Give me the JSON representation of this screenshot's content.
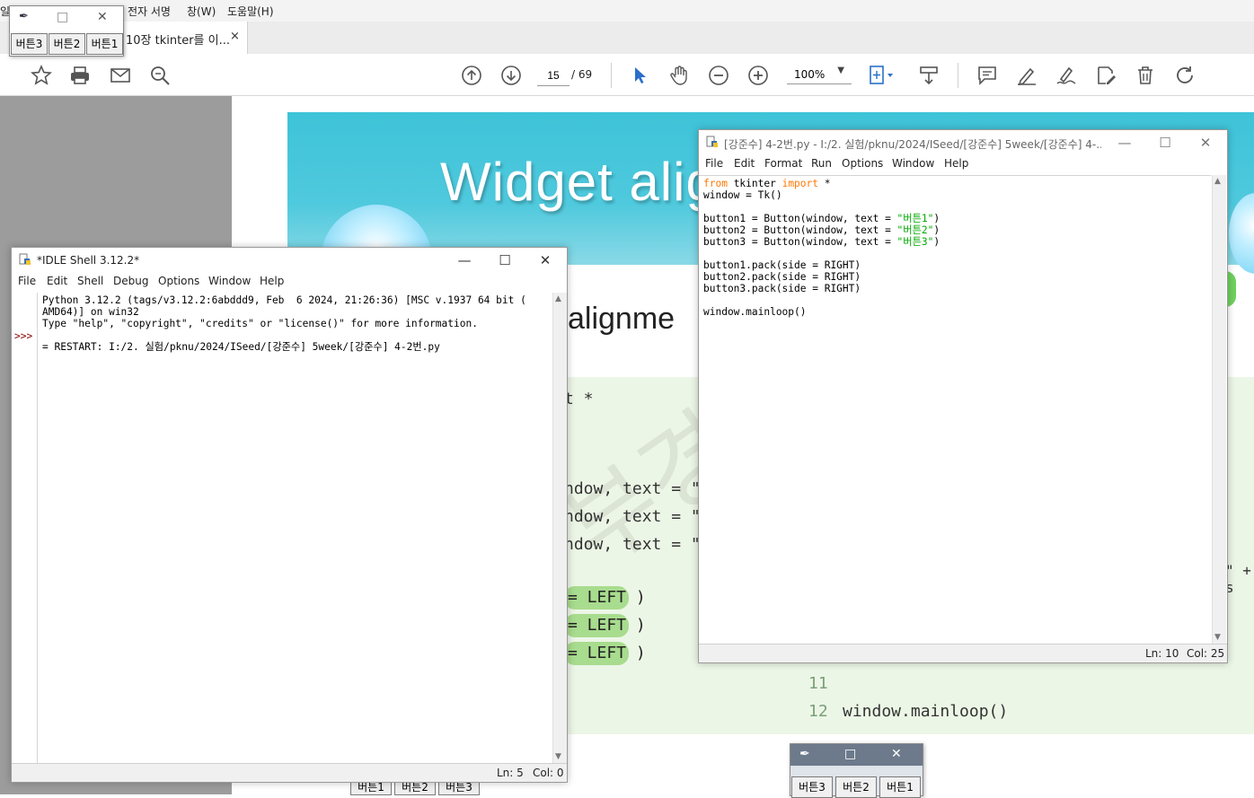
{
  "pdf_reader": {
    "menu": [
      "일",
      "전자 서명",
      "창(W)",
      "도움말(H)"
    ],
    "tab_title": "10장 tkinter를 이...",
    "tab_close": "×",
    "page_current": "15",
    "page_total": "/ 69",
    "zoom": "100%"
  },
  "slide": {
    "title": "Widget alig",
    "subtitle": "alignme",
    "code_fragments": [
      "t *",
      "ndow, text = \"버",
      "ndow, text = \"버",
      "ndow, text = \"버"
    ],
    "left_labels": [
      "= LEFT )",
      "= LEFT )",
      "= LEFT )"
    ],
    "line_11": "11",
    "line_12": "12",
    "line_12_code": "window.mainloop()",
    "watermark": "부경대 P",
    "right_edge_text": "\" + s"
  },
  "tk_window_top": {
    "buttons": [
      "버튼3",
      "버튼2",
      "버튼1"
    ],
    "maximize": "□",
    "close": "✕"
  },
  "tk_window_bottom": {
    "buttons": [
      "버튼3",
      "버튼2",
      "버튼1"
    ],
    "maximize": "□",
    "close": "✕"
  },
  "bottom_pack_buttons": [
    "버튼1",
    "버튼2",
    "버튼3"
  ],
  "idle_shell": {
    "title": "*IDLE Shell 3.12.2*",
    "menu": [
      "File",
      "Edit",
      "Shell",
      "Debug",
      "Options",
      "Window",
      "Help"
    ],
    "prompt": ">>>",
    "lines": [
      "Python 3.12.2 (tags/v3.12.2:6abddd9, Feb  6 2024, 21:26:36) [MSC v.1937 64 bit (",
      "AMD64)] on win32",
      "Type \"help\", \"copyright\", \"credits\" or \"license()\" for more information.",
      "",
      "= RESTART: I:/2. 실험/pknu/2024/ISeed/[강준수] 5week/[강준수] 4-2번.py"
    ],
    "status_ln": "Ln: 5",
    "status_col": "Col: 0"
  },
  "idle_editor": {
    "title": "[강준수] 4-2번.py - I:/2. 실험/pknu/2024/ISeed/[강준수] 5week/[강준수] 4-...",
    "menu": [
      "File",
      "Edit",
      "Format",
      "Run",
      "Options",
      "Window",
      "Help"
    ],
    "code": {
      "l1_kw1": "from",
      "l1_mid": " tkinter ",
      "l1_kw2": "import",
      "l1_end": " *",
      "l2": "window = Tk()",
      "l4_pre": "button1 = Button(window, text = ",
      "l4_str": "\"버튼1\"",
      "l5_pre": "button2 = Button(window, text = ",
      "l5_str": "\"버튼2\"",
      "l6_pre": "button3 = Button(window, text = ",
      "l6_str": "\"버튼3\"",
      "close_paren": ")",
      "l8": "button1.pack(side = RIGHT)",
      "l9": "button2.pack(side = RIGHT)",
      "l10": "button3.pack(side = RIGHT)",
      "l12": "window.mainloop()"
    },
    "status_ln": "Ln: 10",
    "status_col": "Col: 25"
  },
  "window_controls": {
    "minimize": "—",
    "maximize": "☐",
    "close": "✕"
  },
  "colors": {
    "keyword": "#ff7700",
    "string": "#00aa00",
    "banner": "#3ec3d8",
    "code_bg": "#ecf6e6"
  }
}
